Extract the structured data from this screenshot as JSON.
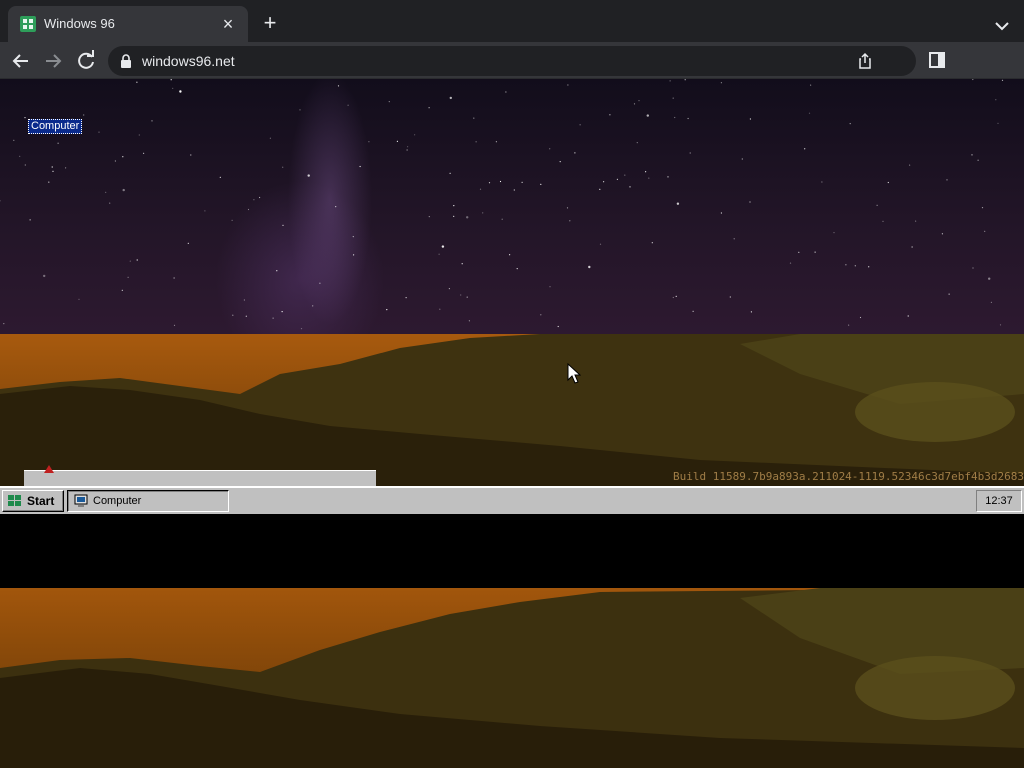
{
  "browser": {
    "tab_title": "Windows 96",
    "url": "windows96.net",
    "icons": {
      "favicon": "windows96-favicon",
      "tab_close": "close-icon",
      "new_tab": "plus-icon",
      "tab_menu": "chevron-down-icon",
      "back": "arrow-left-icon",
      "forward": "arrow-right-icon",
      "reload": "reload-icon",
      "lock": "lock-icon",
      "share": "share-icon",
      "side_panel": "side-panel-icon"
    },
    "colors": {
      "chrome_dark": "#202124",
      "chrome_tab": "#35363a",
      "text": "#e8eaed"
    }
  },
  "desktop": {
    "icons": [
      {
        "label": "Computer"
      }
    ],
    "build_string": "Build 11589.7b9a893a.211024-1119.52346c3d7ebf4b3d2683",
    "wallpaper": "night sky over mountain landscape"
  },
  "taskbar": {
    "start_label": "Start",
    "tasks": [
      {
        "label": "Computer",
        "icon": "computer-icon"
      }
    ],
    "clock": "12:37",
    "colors": {
      "face": "#c0c0c0",
      "highlight": "#0a2a8c"
    }
  }
}
